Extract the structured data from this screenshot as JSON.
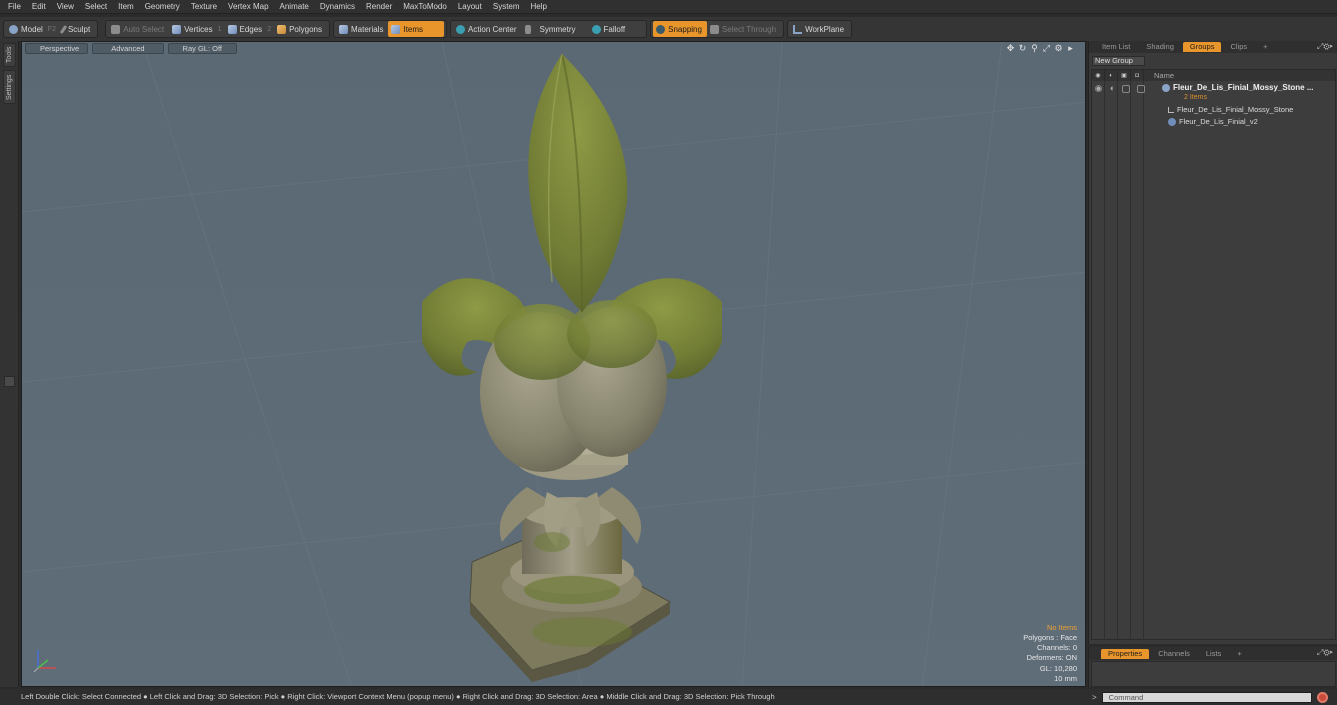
{
  "menu": [
    "File",
    "Edit",
    "View",
    "Select",
    "Item",
    "Geometry",
    "Texture",
    "Vertex Map",
    "Animate",
    "Dynamics",
    "Render",
    "MaxToModo",
    "Layout",
    "System",
    "Help"
  ],
  "toolbar": {
    "model": "Model",
    "model_key": "F2",
    "sculpt": "Sculpt",
    "auto_select": "Auto Select",
    "vertices": "Vertices",
    "vertices_key": "1",
    "edges": "Edges",
    "edges_key": "2",
    "polygons": "Polygons",
    "materials": "Materials",
    "items": "Items",
    "action_center": "Action Center",
    "symmetry": "Symmetry",
    "falloff": "Falloff",
    "snapping": "Snapping",
    "select_through": "Select Through",
    "workplane": "WorkPlane"
  },
  "left_tabs": [
    "Tools",
    "Settings"
  ],
  "viewport": {
    "perspective": "Perspective",
    "advanced": "Advanced",
    "raygl": "Ray GL: Off",
    "stats": {
      "no_items": "No Items",
      "polygons": "Polygons : Face",
      "channels": "Channels: 0",
      "deformers": "Deformers: ON",
      "gl": "GL: 10,280",
      "scale": "10 mm"
    }
  },
  "right_panel": {
    "tabs": [
      "Item List",
      "Shading",
      "Groups",
      "Clips",
      "+"
    ],
    "active_tab": "Groups",
    "new_group": "New Group",
    "column_name": "Name",
    "group_name": "Fleur_De_Lis_Finial_Mossy_Stone ...",
    "group_count": "2 Items",
    "children": [
      "Fleur_De_Lis_Finial_Mossy_Stone",
      "Fleur_De_Lis_Finial_v2"
    ]
  },
  "bottom_panel": {
    "tabs": [
      "Properties",
      "Channels",
      "Lists",
      "+"
    ],
    "active_tab": "Properties"
  },
  "status": "Left Double Click: Select Connected ● Left Click and Drag: 3D Selection: Pick ● Right Click: Viewport Context Menu (popup menu) ● Right Click and Drag: 3D Selection: Area ● Middle Click and Drag: 3D Selection: Pick Through",
  "command_placeholder": "Command",
  "colors": {
    "accent": "#e8962c",
    "viewport_bg": "#5d6c78",
    "moss": "#7d8a3a",
    "stone": "#9d9880"
  }
}
